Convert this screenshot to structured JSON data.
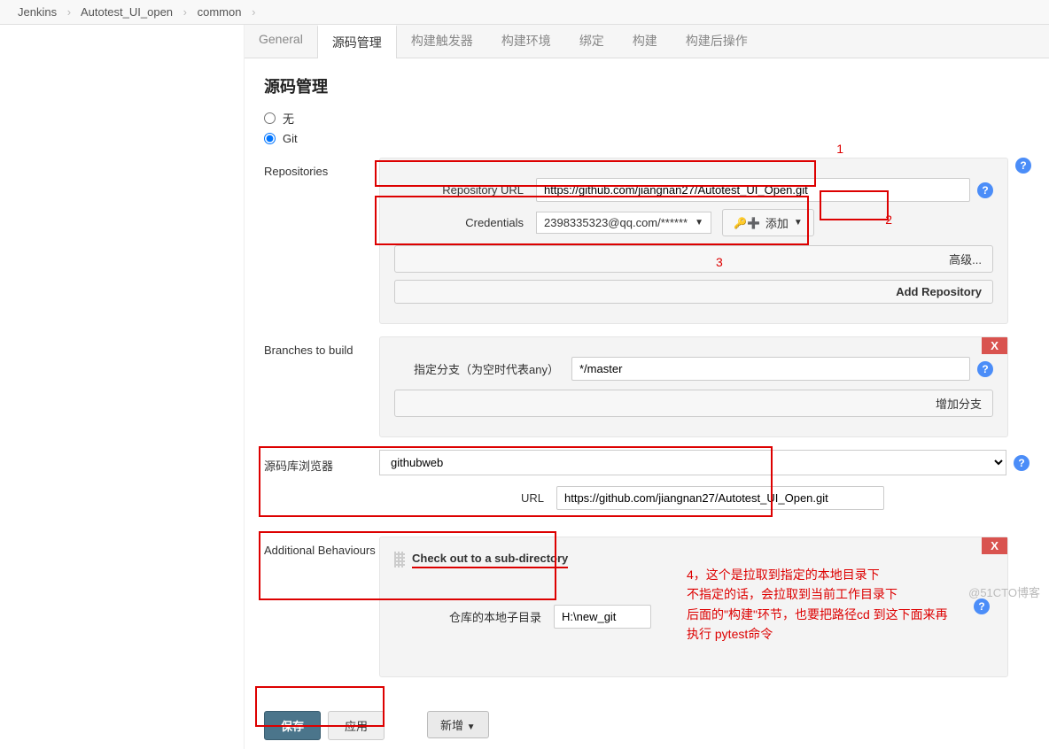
{
  "breadcrumb": {
    "items": [
      "Jenkins",
      "Autotest_UI_open",
      "common"
    ]
  },
  "tabs": [
    "General",
    "源码管理",
    "构建触发器",
    "构建环境",
    "绑定",
    "构建",
    "构建后操作"
  ],
  "active_tab": "源码管理",
  "section_title": "源码管理",
  "scm_options": {
    "none": "无",
    "git": "Git"
  },
  "repositories": {
    "label": "Repositories",
    "url_label": "Repository URL",
    "url_value": "https://github.com/jiangnan27/Autotest_UI_Open.git",
    "cred_label": "Credentials",
    "cred_value": "2398335323@qq.com/******",
    "add_btn": "添加",
    "advanced_btn": "高级...",
    "add_repo_btn": "Add Repository"
  },
  "branches": {
    "label": "Branches to build",
    "branch_label": "指定分支（为空时代表any）",
    "branch_value": "*/master",
    "add_branch_btn": "增加分支"
  },
  "browser": {
    "label": "源码库浏览器",
    "value": "githubweb",
    "url_label": "URL",
    "url_value": "https://github.com/jiangnan27/Autotest_UI_Open.git"
  },
  "behaviours": {
    "label": "Additional Behaviours",
    "item_title": "Check out to a sub-directory",
    "subdir_label": "仓库的本地子目录",
    "subdir_value": "H:\\new_git",
    "add_new": "新增"
  },
  "footer": {
    "save": "保存",
    "apply": "应用"
  },
  "annotations": {
    "n1": "1",
    "n2": "2",
    "n3": "3",
    "note4": "4，这个是拉取到指定的本地目录下\n不指定的话，会拉取到当前工作目录下\n后面的\"构建\"环节，也要把路径cd 到这下面来再\n执行 pytest命令"
  },
  "help_glyph": "?",
  "delete_glyph": "X",
  "watermark": "@51CTO博客"
}
